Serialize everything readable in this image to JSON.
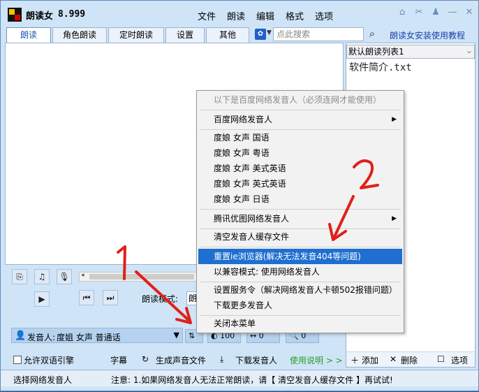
{
  "app": {
    "title": "朗读女",
    "version": "8.999",
    "menus": [
      "文件",
      "朗读",
      "编辑",
      "格式",
      "选项"
    ]
  },
  "tabs": [
    "朗读",
    "角色朗读",
    "定时朗读",
    "设置",
    "其他"
  ],
  "search": {
    "placeholder": "点此搜索"
  },
  "help_link": "朗读女安装使用教程",
  "reading_list": {
    "selected": "默认朗读列表1",
    "items": [
      "软件简介.txt"
    ],
    "add_label": "添加",
    "delete_label": "删除",
    "options_label": "选项"
  },
  "controls": {
    "mode_label": "朗读模式:",
    "mode_value": "朗",
    "voice_label": "发音人:",
    "voice_value": "度姐 女声 普通话",
    "speed": "100",
    "pitch": "0",
    "volume": "0"
  },
  "bottom": {
    "bilingual": "允许双语引擎",
    "subtitle": "字幕",
    "gen_audio": "生成声音文件",
    "download_voice": "下载发音人",
    "usage": "使用说明 > >"
  },
  "status": {
    "left": "选择网络发音人",
    "notice": "注意: 1.如果网络发音人无法正常朗读，请【 清空发音人缓存文件 】再试试!"
  },
  "context_menu": {
    "header": "以下是百度网络发音人（必须连网才能使用）",
    "items": [
      "百度网络发音人",
      "度娘 女声 国语",
      "度娘 女声 粤语",
      "度娘 女声 美式英语",
      "度娘 女声 英式英语",
      "度娘 女声 日语",
      "腾讯优图网络发音人",
      "清空发音人缓存文件",
      "重置ie浏览器(解决无法发音404等问题)",
      "以兼容模式: 使用网络发音人",
      "设置服务令（解决网络发音人卡顿502报错问题）",
      "下载更多发音人",
      "关闭本菜单"
    ]
  },
  "annotations": {
    "one": "1",
    "two": "2"
  },
  "colors": {
    "accent": "#1e6fd0",
    "annotation_red": "#e0201a",
    "link": "#1a40a8",
    "window_bg": "#cfe4f7"
  }
}
